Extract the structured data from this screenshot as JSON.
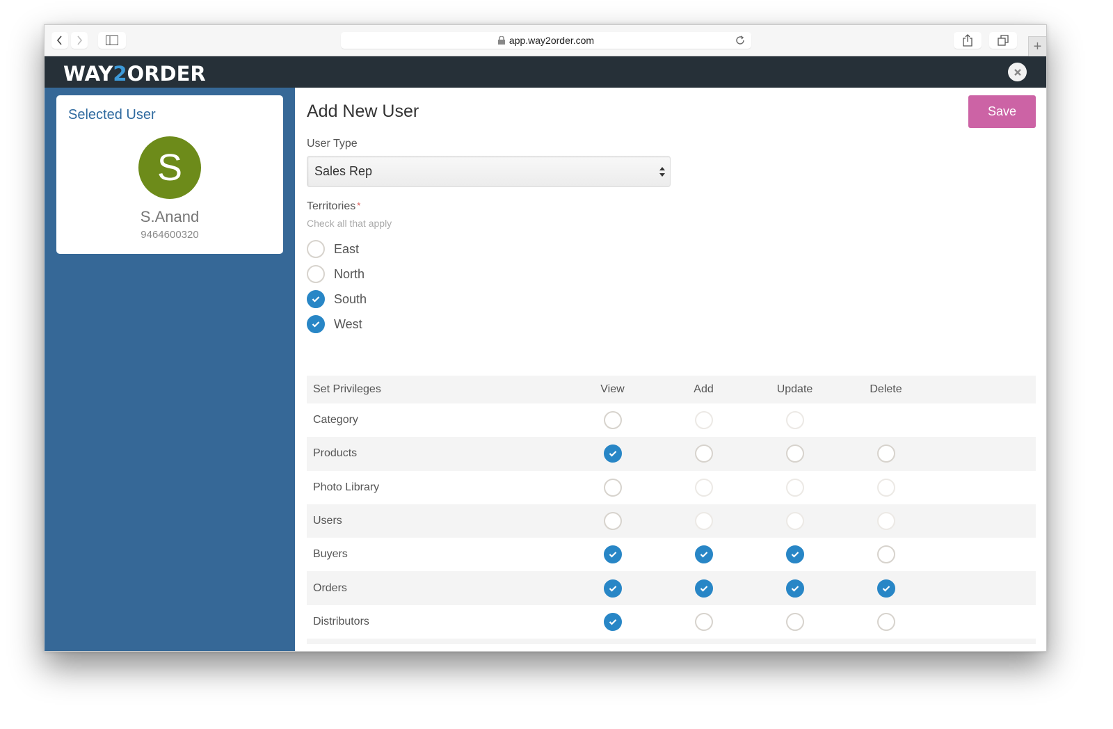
{
  "browser": {
    "url": "app.way2order.com",
    "back_icon": "chevron-left-icon",
    "forward_icon": "chevron-right-icon",
    "sidebar_icon": "sidebar-icon",
    "lock_icon": "lock-icon",
    "reload_icon": "reload-icon",
    "share_icon": "share-icon",
    "tabs_icon": "tabs-icon",
    "new_tab_label": "+"
  },
  "app": {
    "logo_part1": "WAY",
    "logo_part2": "2",
    "logo_part3": "ORDER",
    "close_icon": "close-icon",
    "brand_color": "#263038",
    "accent_color": "#3d9ad9"
  },
  "selected_user": {
    "title": "Selected User",
    "avatar_letter": "S",
    "avatar_color": "#6d8b1a",
    "name": "S.Anand",
    "phone": "9464600320"
  },
  "form": {
    "title": "Add New User",
    "save_label": "Save",
    "save_color": "#cc63a5",
    "user_type_label": "User Type",
    "user_type_value": "Sales Rep",
    "territories_label": "Territories",
    "territories_required": "*",
    "territories_hint": "Check all that apply",
    "territories": [
      {
        "label": "East",
        "checked": false
      },
      {
        "label": "North",
        "checked": false
      },
      {
        "label": "South",
        "checked": true
      },
      {
        "label": "West",
        "checked": true
      }
    ]
  },
  "privileges": {
    "header": "Set Privileges",
    "columns": [
      "View",
      "Add",
      "Update",
      "Delete"
    ],
    "rows": [
      {
        "name": "Category",
        "cells": [
          {
            "state": "off"
          },
          {
            "state": "disabled"
          },
          {
            "state": "disabled"
          },
          {
            "state": "none"
          }
        ]
      },
      {
        "name": "Products",
        "cells": [
          {
            "state": "on"
          },
          {
            "state": "off"
          },
          {
            "state": "off"
          },
          {
            "state": "off"
          }
        ]
      },
      {
        "name": "Photo Library",
        "cells": [
          {
            "state": "off"
          },
          {
            "state": "disabled"
          },
          {
            "state": "disabled"
          },
          {
            "state": "disabled"
          }
        ]
      },
      {
        "name": "Users",
        "cells": [
          {
            "state": "off"
          },
          {
            "state": "disabled"
          },
          {
            "state": "disabled"
          },
          {
            "state": "disabled"
          }
        ]
      },
      {
        "name": "Buyers",
        "cells": [
          {
            "state": "on"
          },
          {
            "state": "on"
          },
          {
            "state": "on"
          },
          {
            "state": "off"
          }
        ]
      },
      {
        "name": "Orders",
        "cells": [
          {
            "state": "on"
          },
          {
            "state": "on"
          },
          {
            "state": "on"
          },
          {
            "state": "on"
          }
        ]
      },
      {
        "name": "Distributors",
        "cells": [
          {
            "state": "on"
          },
          {
            "state": "off"
          },
          {
            "state": "off"
          },
          {
            "state": "off"
          }
        ]
      }
    ],
    "checked_color": "#2886c6"
  }
}
